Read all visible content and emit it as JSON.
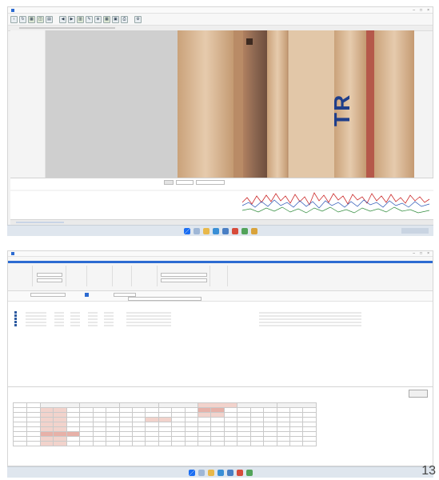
{
  "top_window": {
    "title": "",
    "menu": [
      "",
      "",
      "",
      ""
    ],
    "channel_label": "",
    "status_bar_left": "",
    "image_text": "TR",
    "colors": {
      "viewer_bg": "#cfcfcf",
      "wood": "#d7b593",
      "pipe_dark": "#5a4638",
      "trace_red": "#cc2b2b",
      "trace_green": "#2e8b3a",
      "trace_blue": "#2b56b5"
    }
  },
  "bottom_window": {
    "title": "",
    "menu": [
      "",
      "",
      "",
      "",
      "",
      "",
      ""
    ],
    "results_header": "",
    "files": [
      {
        "name": "",
        "path": ""
      },
      {
        "name": "",
        "path": ""
      },
      {
        "name": "",
        "path": ""
      },
      {
        "name": "",
        "path": ""
      },
      {
        "name": "",
        "path": ""
      }
    ],
    "summary_title": "",
    "summary_subtitle": "",
    "table_rows": 8,
    "side_button": ""
  },
  "page_number": "13",
  "colors": {
    "taskbar": "#dfe6ee",
    "accent": "#1b6ef3"
  }
}
